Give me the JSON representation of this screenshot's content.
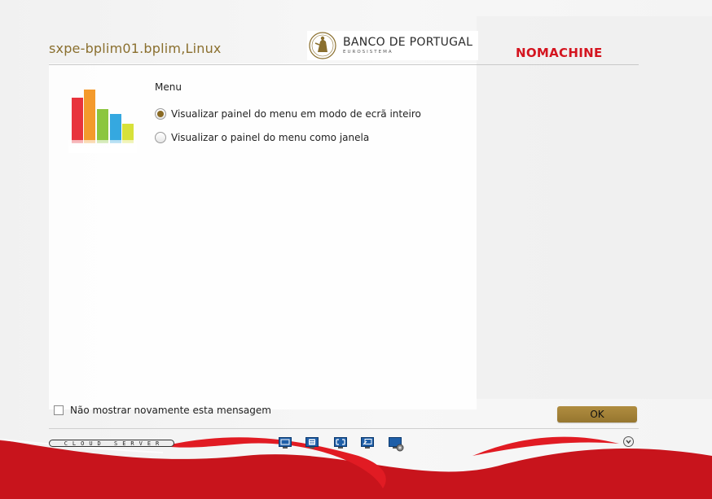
{
  "header": {
    "host_title": "sxpe-bplim01.bplim,Linux",
    "brand_name": "BANCO DE PORTUGAL",
    "brand_sub": "EUROSISTEMA",
    "nomachine": "NOMACHINE"
  },
  "menu": {
    "heading": "Menu",
    "options": [
      {
        "label": "Visualizar painel do menu em modo de ecrã inteiro",
        "selected": true
      },
      {
        "label": "Visualizar o painel do menu como janela",
        "selected": false
      }
    ]
  },
  "footer": {
    "checkbox_label": "Não mostrar novamente esta mensagem",
    "checkbox_checked": false,
    "ok_label": "OK",
    "cloud_server": "CLOUD SERVER",
    "toolbar_icons": [
      "fit-display-icon",
      "menu-panel-icon",
      "fullscreen-icon",
      "window-icon",
      "display-settings-icon"
    ]
  },
  "colors": {
    "accent_gold": "#96762f",
    "brand_red": "#d4141f",
    "wave_red": "#c8141c"
  },
  "chart_icon_colors": [
    "#e8333c",
    "#f49a2c",
    "#8cc63f",
    "#35a8e0",
    "#d7e13a"
  ]
}
